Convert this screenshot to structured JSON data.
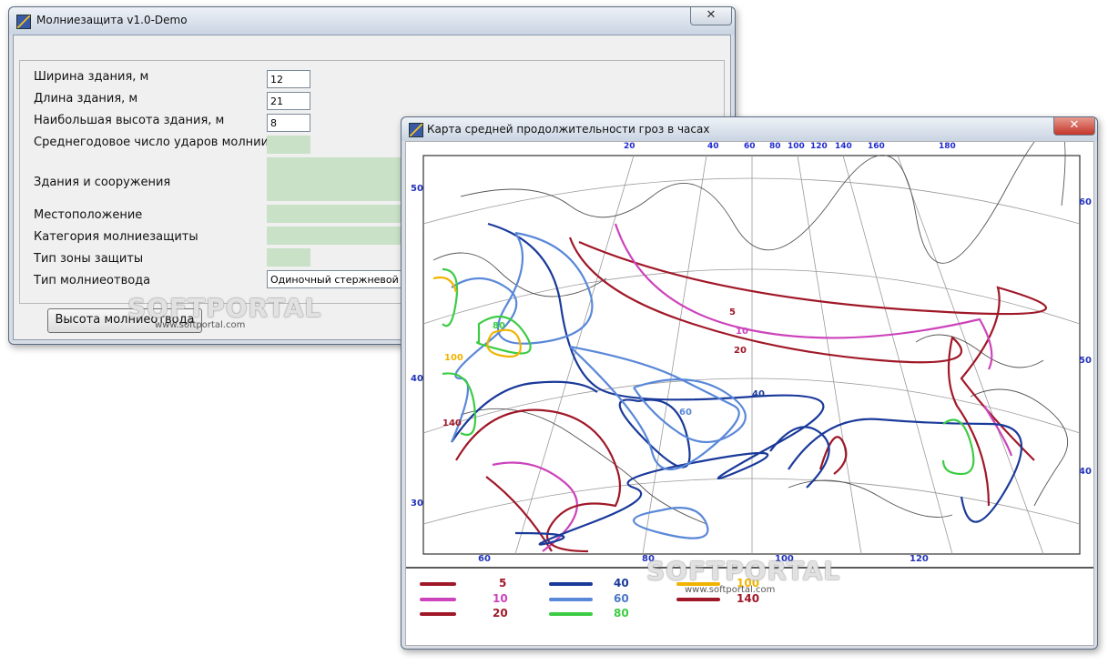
{
  "main_window": {
    "title": "Молниезащита v1.0-Demo",
    "close_glyph": "✕",
    "fields": [
      {
        "label": "Ширина здания, м",
        "value": "12"
      },
      {
        "label": "Длина здания, м",
        "value": "21"
      },
      {
        "label": "Наибольшая высота здания, м",
        "value": "8"
      }
    ],
    "output_labels": {
      "strikes": "Среднегодовое число ударов молнии",
      "buildings": "Здания и сооружения",
      "location": "Местоположение",
      "category": "Категория молниезащиты",
      "zone_type": "Тип зоны защиты",
      "rod_type": "Тип молниеотвода"
    },
    "rod_type_value": "Одиночный стержневой молниеотвод",
    "compute_button": "Высота молниеотвода"
  },
  "map_window": {
    "title": "Карта средней продолжительности гроз в часах",
    "close_glyph": "✕",
    "top_ticks": [
      "20",
      "40",
      "60",
      "80",
      "100",
      "120",
      "140",
      "160",
      "180"
    ],
    "bottom_ticks": [
      "60",
      "80",
      "100",
      "120"
    ],
    "left_ticks": [
      "50",
      "40",
      "30"
    ],
    "right_ticks": [
      "60",
      "50",
      "40"
    ],
    "legend": [
      {
        "value": "5",
        "color": "#a01828"
      },
      {
        "value": "10",
        "color": "#cc44bb"
      },
      {
        "value": "20",
        "color": "#a01828"
      },
      {
        "value": "40",
        "color": "#1a3a9a"
      },
      {
        "value": "60",
        "color": "#5a88d8"
      },
      {
        "value": "80",
        "color": "#3ccc44"
      },
      {
        "value": "100",
        "color": "#f0b400"
      },
      {
        "value": "140",
        "color": "#a01828"
      }
    ],
    "contour_labels": [
      "5",
      "10",
      "20",
      "40",
      "60",
      "80",
      "100",
      "140"
    ]
  },
  "watermark": {
    "brand": "SOFTPORTAL",
    "site": "www.softportal.com"
  }
}
